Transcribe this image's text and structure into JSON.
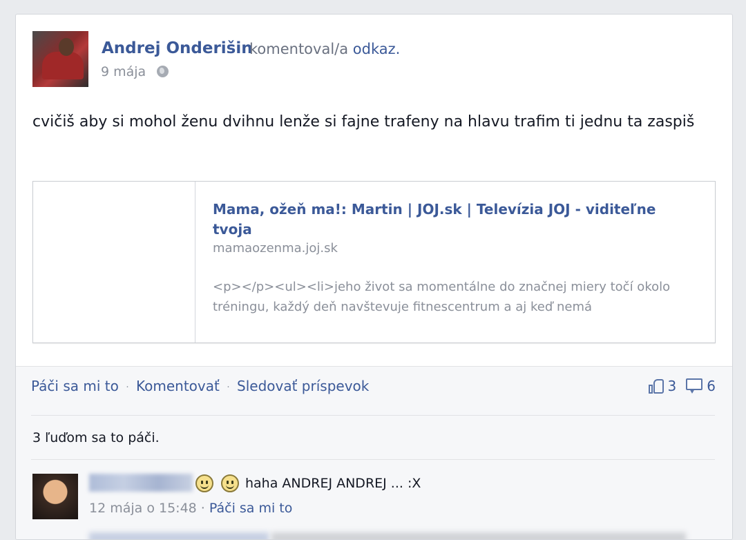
{
  "post": {
    "author": "Andrej Onderišin",
    "action": "komentoval/a",
    "object": "odkaz.",
    "date": "9 mája",
    "message": "cvičiš aby si mohol ženu dvihnu lenže si fajne trafeny na hlavu trafim ti jednu ta zaspiš"
  },
  "link": {
    "title": "Mama, ožeň ma!: Martin | JOJ.sk | Televízia JOJ - viditeľne tvoja",
    "domain": "mamaozenma.joj.sk",
    "description": "<p></p><ul><li>jeho život sa momentálne do značnej miery točí okolo tréningu, každý deň navštevuje fitnescentrum a aj keď nemá"
  },
  "actions": {
    "like": "Páči sa mi to",
    "comment": "Komentovať",
    "follow": "Sledovať príspevok",
    "separator": "·",
    "like_count": "3",
    "comment_count": "6"
  },
  "likes_summary": "3 ľuďom sa to páči.",
  "comment": {
    "text": "haha ANDREJ ANDREJ ... :X",
    "timestamp": "12 mája o 15:48",
    "separator": "·",
    "like": "Páči sa mi to"
  },
  "colors": {
    "link_blue": "#3b5998",
    "muted_gray": "#8a8f99",
    "panel_bg": "#f6f7f9"
  }
}
